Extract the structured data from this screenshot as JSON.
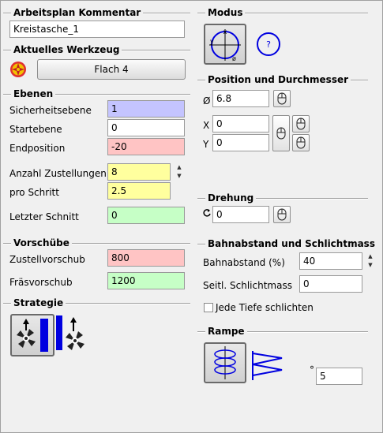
{
  "kommentar": {
    "title": "Arbeitsplan Kommentar",
    "value": "Kreistasche_1"
  },
  "werkzeug": {
    "title": "Aktuelles Werkzeug",
    "tool_button": "Flach 4"
  },
  "ebenen": {
    "title": "Ebenen",
    "sicherheitsebene": {
      "label": "Sicherheitsebene",
      "value": "1",
      "color": "#c4c4ff"
    },
    "startebene": {
      "label": "Startebene",
      "value": "0",
      "color": "#ffffff"
    },
    "endposition": {
      "label": "Endposition",
      "value": "-20",
      "color": "#ffc4c4"
    },
    "anzahl_zustellungen": {
      "label": "Anzahl Zustellungen",
      "value": "8",
      "color": "#ffff9e"
    },
    "pro_schritt": {
      "label": "pro Schritt",
      "value": "2.5",
      "color": "#ffff9e"
    },
    "letzter_schnitt": {
      "label": "Letzter Schnitt",
      "value": "0",
      "color": "#c6ffc6"
    }
  },
  "vorschuebe": {
    "title": "Vorschübe",
    "zustellvorschub": {
      "label": "Zustellvorschub",
      "value": "800",
      "color": "#ffc4c4"
    },
    "fraesvorschub": {
      "label": "Fräsvorschub",
      "value": "1200",
      "color": "#c6ffc6"
    }
  },
  "strategie": {
    "title": "Strategie"
  },
  "modus": {
    "title": "Modus",
    "mode_icon_x": "x",
    "mode_icon_y": "y",
    "mode_icon_diameter": "ø",
    "help_label": "?"
  },
  "position": {
    "title": "Position und Durchmesser",
    "diameter_symbol": "Ø",
    "diameter_value": "6.8",
    "x_label": "X",
    "x_value": "0",
    "y_label": "Y",
    "y_value": "0"
  },
  "drehung": {
    "title": "Drehung",
    "value": "0"
  },
  "bahnabstand": {
    "title": "Bahnabstand und Schlichtmass",
    "bahnabstand_label": "Bahnabstand (%)",
    "bahnabstand_value": "40",
    "schlichtmass_label": "Seitl. Schlichtmass",
    "schlichtmass_value": "0",
    "jede_tiefe_label": "Jede Tiefe schlichten",
    "jede_tiefe_checked": false
  },
  "rampe": {
    "title": "Rampe",
    "degree_symbol": "°",
    "angle_value": "5"
  },
  "colors": {
    "accent_blue": "#0000e0",
    "tool_red": "#e03030",
    "tool_yellow": "#f2c200"
  }
}
